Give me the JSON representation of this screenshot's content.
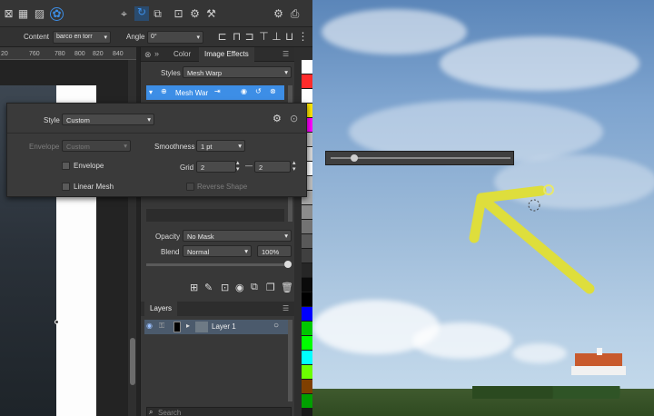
{
  "toolbar": {
    "icons": [
      "grid-icon",
      "grid-icon",
      "pattern-icon",
      "color-wheel-icon",
      "node-icon",
      "rotate-icon",
      "crop-icon",
      "transform-icon",
      "gear-icon",
      "fx-icon",
      "settings-icon",
      "print-icon"
    ]
  },
  "contextbar": {
    "content_label": "Content",
    "content_value": "barco en torr",
    "angle_label": "Angle",
    "angle_value": "0°"
  },
  "ruler": {
    "ticks": [
      "20",
      "760",
      "780",
      "800",
      "820",
      "840"
    ]
  },
  "panel": {
    "tabs": [
      "Color",
      "Image Effects"
    ],
    "styles_label": "Styles",
    "styles_value": "Mesh Warp",
    "effect_name": "Mesh War",
    "opacity_label": "Opacity",
    "opacity_value": "No Mask",
    "blend_label": "Blend",
    "blend_value": "Normal",
    "blend_percent": "100%",
    "layers_tab": "Layers",
    "layer_name": "Layer 1",
    "search_placeholder": "Search"
  },
  "dialog": {
    "style_label": "Style",
    "style_value": "Custom",
    "envelope_label": "Envelope",
    "envelope_value": "Custom",
    "smoothness_label": "Smoothness",
    "smoothness_value": "1 pt",
    "envelope_check": "Envelope",
    "grid_label": "Grid",
    "grid_x": "2",
    "grid_dash": "—",
    "grid_y": "2",
    "linear_mesh": "Linear Mesh",
    "reverse_shape": "Reverse Shape"
  },
  "slider": {
    "level": 0.13
  },
  "colors": {
    "accent": "#3d8ee6",
    "arrow": "#dede3c",
    "palette": [
      "#ffffff",
      "#ff2b2b",
      "#ffffff",
      "#ffe600",
      "#ff00ff",
      "#c0c0c0",
      "#d9d9d9",
      "#ffffff",
      "#bfbfbf",
      "#a6a6a6",
      "#8c8c8c",
      "#737373",
      "#595959",
      "#404040",
      "#262626",
      "#0a0a0a",
      "#000000",
      "#0000ff",
      "#00c800",
      "#00ff00",
      "#00ffff",
      "#6cff00",
      "#7f3f00",
      "#00a000"
    ]
  }
}
